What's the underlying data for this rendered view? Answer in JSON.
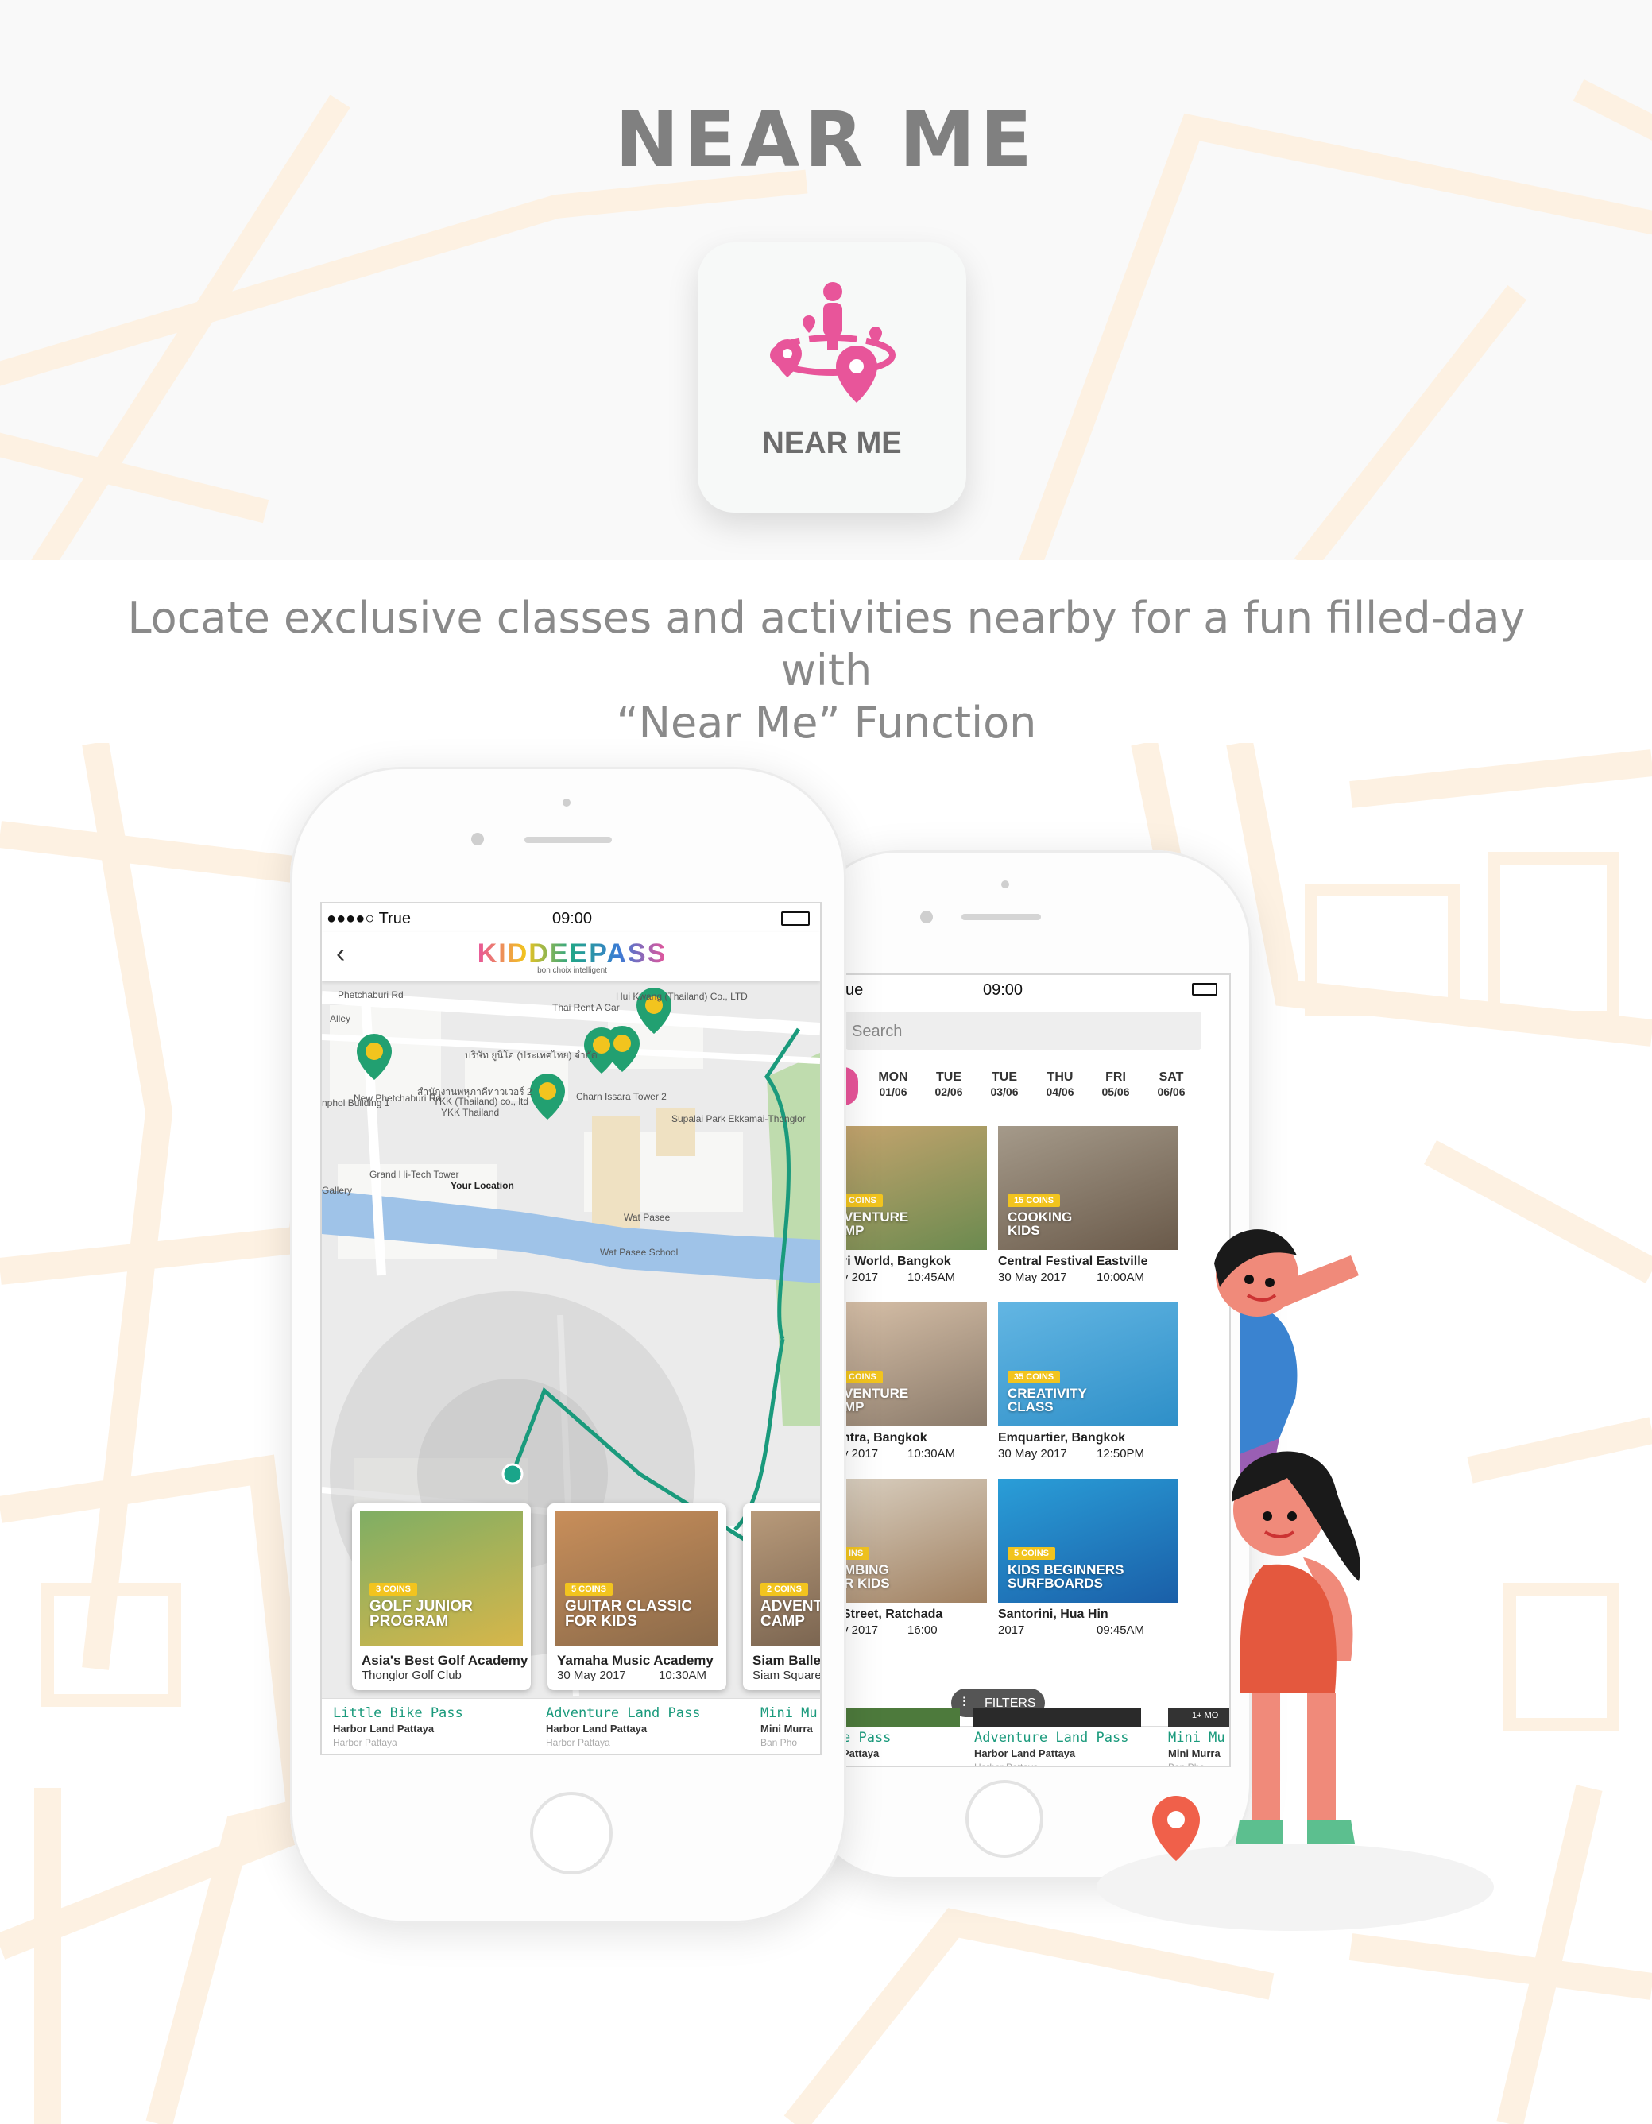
{
  "header": {
    "title": "NEAR ME"
  },
  "feature_icon": {
    "label": "NEAR ME",
    "icon": "near-me-location-icon",
    "color": "#e8559a"
  },
  "description": {
    "line1": "Locate exclusive classes and activities nearby for a fun filled-day with",
    "line2": "“Near Me” Function"
  },
  "colors": {
    "accent_pink": "#e8559a",
    "accent_green": "#1a9a7c",
    "coin_yellow": "#f2c41e",
    "road_beige": "#fdf3e6"
  },
  "phone1": {
    "status": {
      "carrier": "●●●●○ True",
      "time": "09:00"
    },
    "nav": {
      "back_icon": "chevron-left-icon",
      "logo": "KIDDEEPASS",
      "tagline": "bon choix intelligent"
    },
    "map": {
      "labels": [
        "Phetchaburi Rd",
        "Hui Kwang (Thailand) Co., LTD",
        "Thai Rent A Car",
        "บริษัท ยูนิโอ (ประเทศไทย) จำกัด",
        "Alley",
        "New Phetchaburi Rd",
        "สำนักงานพหุภาคีทาวเวอร์ 2",
        "YKK (Thailand) co., ltd",
        "YKK Thailand",
        "nphol Building 1",
        "Charn Issara Tower 2",
        "Supalai Park Ekkamai-Thonglor",
        "Grand Hi-Tech Tower",
        "Your Location",
        "Wat Pasee",
        "Wat Pasee School",
        "Gallery"
      ],
      "pin_icon": "school-pin-icon",
      "your_location": "Your Location"
    },
    "cards": [
      {
        "coins": "3 COINS",
        "title1": "GOLF JUNIOR",
        "title2": "PROGRAM",
        "name": "Asia's Best Golf Academy",
        "sub": "Thonglor Golf Club",
        "date": "",
        "time": ""
      },
      {
        "coins": "5 COINS",
        "title1": "GUITAR CLASSIC",
        "title2": "FOR KIDS",
        "name": "Yamaha Music Academy",
        "sub": "",
        "date": "30 May 2017",
        "time": "10:30AM"
      },
      {
        "coins": "2 COINS",
        "title1": "ADVENTU",
        "title2": "CAMP",
        "name": "Siam Ballet",
        "sub": "Siam Square",
        "date": "",
        "time": ""
      }
    ],
    "passes": [
      {
        "name": "Little Bike Pass",
        "venue": "Harbor Land Pattaya",
        "area": "Harbor Pattaya"
      },
      {
        "name": "Adventure Land Pass",
        "venue": "Harbor Land Pattaya",
        "area": "Harbor Pattaya"
      },
      {
        "name": "Mini Mu",
        "venue": "Mini Murra",
        "area": "Ban Pho"
      }
    ]
  },
  "phone2": {
    "status": {
      "carrier": "ue",
      "time": "09:00"
    },
    "search": {
      "placeholder": "Search"
    },
    "days": [
      {
        "day": "MON",
        "date": "01/06"
      },
      {
        "day": "TUE",
        "date": "02/06"
      },
      {
        "day": "TUE",
        "date": "03/06"
      },
      {
        "day": "THU",
        "date": "04/06"
      },
      {
        "day": "FRI",
        "date": "05/06"
      },
      {
        "day": "SAT",
        "date": "06/06"
      }
    ],
    "grid": [
      {
        "coins": "COINS",
        "title1": "VENTURE",
        "title2": "MP",
        "place": "ri World, Bangkok",
        "date": "y 2017",
        "time": "10:45AM"
      },
      {
        "coins": "15 COINS",
        "title1": "COOKING",
        "title2": "KIDS",
        "place": "Central Festival Eastville",
        "date": "30 May 2017",
        "time": "10:00AM"
      },
      {
        "coins": "COINS",
        "title1": "VENTURE",
        "title2": "MP",
        "place": "ntra, Bangkok",
        "date": "y 2017",
        "time": "10:30AM"
      },
      {
        "coins": "35 COINS",
        "title1": "CREATIVITY",
        "title2": "CLASS",
        "place": "Emquartier, Bangkok",
        "date": "30 May 2017",
        "time": "12:50PM"
      },
      {
        "coins": "INS",
        "title1": "MBING",
        "title2": "R KIDS",
        "place": "Street, Ratchada",
        "date": "y 2017",
        "time": "16:00"
      },
      {
        "coins": "5 COINS",
        "title1": "KIDS BEGINNERS",
        "title2": "SURFBOARDS",
        "place": "Santorini, Hua Hin",
        "date": "2017",
        "time": "09:45AM"
      }
    ],
    "filters_label": "FILTERS",
    "filters_icon": "sliders-icon",
    "passes": [
      {
        "name": "e Pass",
        "venue": "Pattaya",
        "area": ""
      },
      {
        "name": "Adventure Land Pass",
        "venue": "Harbor Land Pattaya",
        "area": "Harbor Pattaya"
      },
      {
        "name": "Mini Mu",
        "venue": "Mini Murra",
        "area": "Ban Pho"
      }
    ],
    "more_badge": "1+ MO"
  },
  "illustration": {
    "pin_icon": "location-pin-icon",
    "characters": [
      "waving-kid",
      "walking-girl"
    ]
  }
}
